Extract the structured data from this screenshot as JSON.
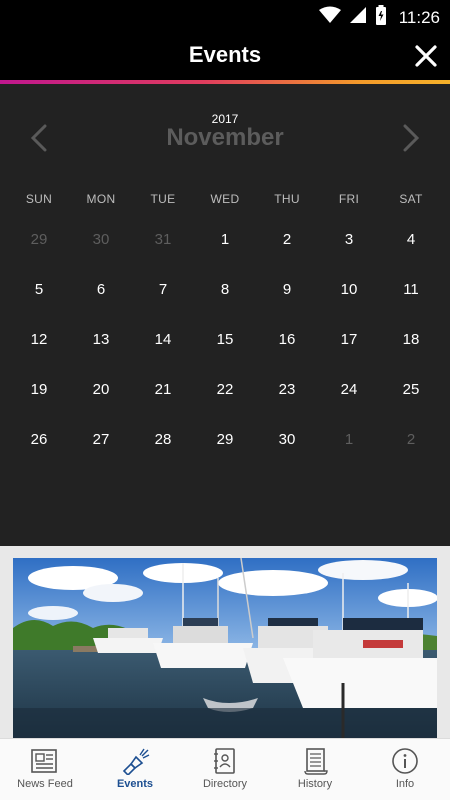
{
  "status_bar": {
    "time": "11:26",
    "icons": [
      "wifi-icon",
      "signal-icon",
      "battery-icon"
    ]
  },
  "app_bar": {
    "title": "Events",
    "close_icon": "close-icon"
  },
  "calendar": {
    "year": "2017",
    "month": "November",
    "prev_icon": "chevron-left-icon",
    "next_icon": "chevron-right-icon",
    "weekdays": [
      "SUN",
      "MON",
      "TUE",
      "WED",
      "THU",
      "FRI",
      "SAT"
    ],
    "days": [
      {
        "label": "29",
        "current": false
      },
      {
        "label": "30",
        "current": false
      },
      {
        "label": "31",
        "current": false
      },
      {
        "label": "1",
        "current": true
      },
      {
        "label": "2",
        "current": true
      },
      {
        "label": "3",
        "current": true
      },
      {
        "label": "4",
        "current": true
      },
      {
        "label": "5",
        "current": true
      },
      {
        "label": "6",
        "current": true
      },
      {
        "label": "7",
        "current": true
      },
      {
        "label": "8",
        "current": true
      },
      {
        "label": "9",
        "current": true
      },
      {
        "label": "10",
        "current": true
      },
      {
        "label": "11",
        "current": true
      },
      {
        "label": "12",
        "current": true
      },
      {
        "label": "13",
        "current": true
      },
      {
        "label": "14",
        "current": true
      },
      {
        "label": "15",
        "current": true
      },
      {
        "label": "16",
        "current": true
      },
      {
        "label": "17",
        "current": true
      },
      {
        "label": "18",
        "current": true
      },
      {
        "label": "19",
        "current": true
      },
      {
        "label": "20",
        "current": true
      },
      {
        "label": "21",
        "current": true
      },
      {
        "label": "22",
        "current": true
      },
      {
        "label": "23",
        "current": true
      },
      {
        "label": "24",
        "current": true
      },
      {
        "label": "25",
        "current": true
      },
      {
        "label": "26",
        "current": true
      },
      {
        "label": "27",
        "current": true
      },
      {
        "label": "28",
        "current": true
      },
      {
        "label": "29",
        "current": true
      },
      {
        "label": "30",
        "current": true
      },
      {
        "label": "1",
        "current": false
      },
      {
        "label": "2",
        "current": false
      }
    ]
  },
  "photo": {
    "subject": "marina-boats-photo"
  },
  "bottom_nav": {
    "items": [
      {
        "label": "News Feed",
        "icon": "newspaper-icon",
        "active": false
      },
      {
        "label": "Events",
        "icon": "flashlight-icon",
        "active": true
      },
      {
        "label": "Directory",
        "icon": "address-book-icon",
        "active": false
      },
      {
        "label": "History",
        "icon": "scroll-icon",
        "active": false
      },
      {
        "label": "Info",
        "icon": "info-icon",
        "active": false
      }
    ]
  },
  "colors": {
    "calendar_bg": "#222222",
    "accent_gradient": [
      "#c0178e",
      "#f6b22a"
    ],
    "active_nav": "#1d4f91"
  }
}
